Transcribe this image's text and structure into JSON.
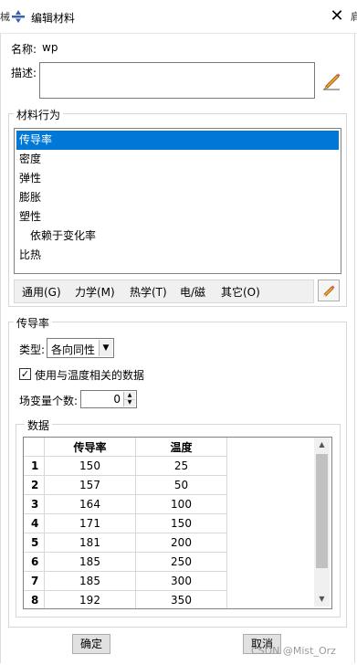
{
  "window": {
    "title": "编辑材料",
    "close": "✕",
    "edge_left": "械",
    "edge_right": "肩"
  },
  "name": {
    "label": "名称:",
    "value": "wp"
  },
  "description": {
    "label": "描述:",
    "value": ""
  },
  "behavior_group": {
    "title": "材料行为",
    "items": [
      {
        "label": "传导率",
        "selected": true
      },
      {
        "label": "密度"
      },
      {
        "label": "弹性"
      },
      {
        "label": "膨胀"
      },
      {
        "label": "塑性"
      },
      {
        "label": "依赖于变化率"
      },
      {
        "label": "比热"
      }
    ]
  },
  "menubar": {
    "items": [
      "通用(G)",
      "力学(M)",
      "热学(T)",
      "电/磁",
      "其它(O)"
    ]
  },
  "conductivity": {
    "title": "传导率",
    "type_label": "类型:",
    "type_value": "各向同性",
    "temp_dep_label": "使用与温度相关的数据",
    "temp_dep_checked": true,
    "field_vars_label": "场变量个数:",
    "field_vars_value": "0",
    "data_title": "数据",
    "columns": [
      "传导率",
      "温度"
    ],
    "rows": [
      {
        "index": "1",
        "k": "150",
        "t": "25"
      },
      {
        "index": "2",
        "k": "157",
        "t": "50"
      },
      {
        "index": "3",
        "k": "164",
        "t": "100"
      },
      {
        "index": "4",
        "k": "171",
        "t": "150"
      },
      {
        "index": "5",
        "k": "181",
        "t": "200"
      },
      {
        "index": "6",
        "k": "185",
        "t": "250"
      },
      {
        "index": "7",
        "k": "185",
        "t": "300"
      },
      {
        "index": "8",
        "k": "192",
        "t": "350"
      }
    ]
  },
  "buttons": {
    "ok": "确定",
    "cancel": "取消"
  },
  "watermark": "CSDN @Mist_Orz",
  "colors": {
    "selection": "#0078d7",
    "accent_pencil": "#f0a030"
  }
}
